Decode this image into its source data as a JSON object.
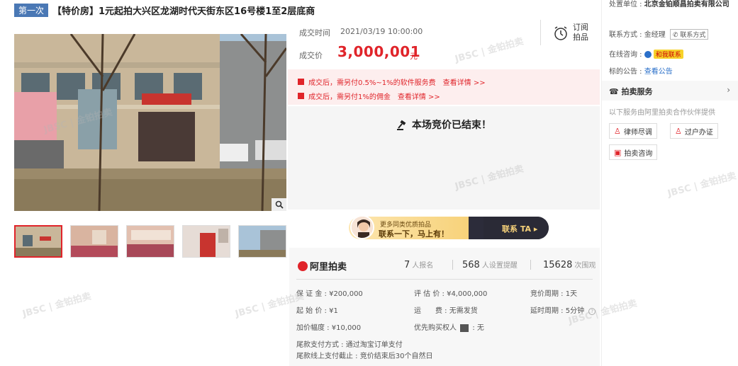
{
  "title": {
    "round_tag": "第一次",
    "text": "【特价房】1元起拍大兴区龙湖时代天街东区16号楼1至2层底商"
  },
  "deal": {
    "time_label": "成交时间",
    "time_value": "2021/03/19 10:00:00",
    "price_label": "成交价",
    "price_value": "3,000,001",
    "price_unit": "元"
  },
  "subscribe": {
    "line1": "订阅",
    "line2": "拍品",
    "icon": "clock-icon"
  },
  "fees": [
    {
      "text": "成交后，需另付0.5%~1%的软件服务费",
      "link": "查看详情 >>"
    },
    {
      "text": "成交后，需另付1%的佣金",
      "link": "查看详情 >>"
    }
  ],
  "ended": {
    "text": "本场竞价已结束！",
    "icon": "gavel-icon"
  },
  "banner": {
    "small": "更多同类优质拍品",
    "big": "联系一下，马上有！",
    "cta": "联系 TA ▸"
  },
  "stats": {
    "logo": "阿里拍卖",
    "signups_value": "7",
    "signups_label": "人报名",
    "reminders_value": "568",
    "reminders_label": "人设置提醒",
    "views_value": "15628",
    "views_label": "次围观"
  },
  "info": {
    "deposit": "保 证 金 : ¥200,000",
    "appraisal": "评 估 价 : ¥4,000,000",
    "cycle": "竞价周期 : 1天",
    "start_price": "起 始 价 : ¥1",
    "shipping": "运　　费 : 无需发货",
    "delay": "延时周期 : 5分钟",
    "increment": "加价幅度 : ¥10,000",
    "priority": "优先购买权人",
    "priority_value": ": 无",
    "payment_method": "尾款支付方式 :  通过淘宝订单支付",
    "payment_deadline": "尾款线上支付截止 :  竞价结束后30个自然日"
  },
  "right": {
    "unit_label": "处置单位 :",
    "unit_value": "北京金铂顺昌拍卖有限公司",
    "contact_label": "联系方式 :",
    "contact_name": "金经理",
    "contact_btn": "联系方式",
    "online_label": "在线咨询 :",
    "online_btn": "和我联系",
    "notice_label": "标的公告 :",
    "notice_link": "查看公告",
    "service_title": "拍卖服务",
    "service_sub": "以下服务由阿里拍卖合作伙伴提供",
    "svc_lawyer": "律师尽调",
    "svc_transfer": "过户办证",
    "svc_consult": "拍卖咨询"
  },
  "watermark": "JBSC | 金铂拍卖",
  "colors": {
    "accent_red": "#e0242a",
    "tag_blue": "#4a78b5",
    "link_blue": "#2a6fc9"
  }
}
